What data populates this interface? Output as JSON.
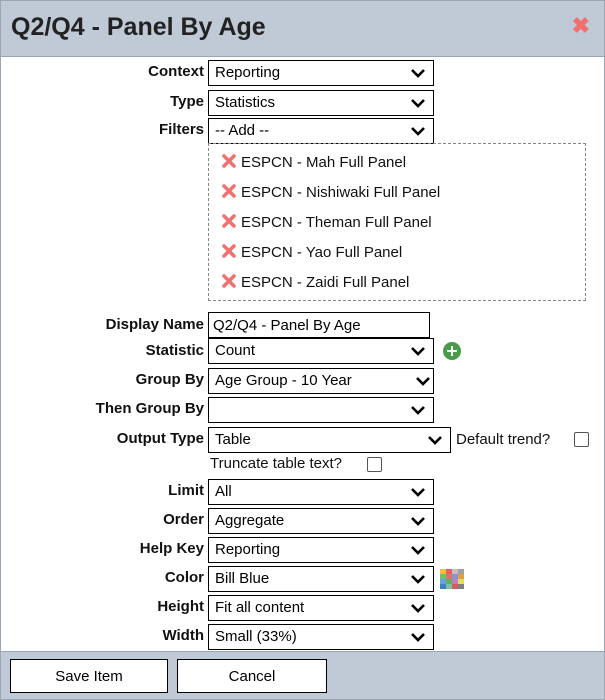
{
  "dialog": {
    "title": "Q2/Q4 - Panel By Age",
    "close_icon": "close-x-icon"
  },
  "form": {
    "context": {
      "label": "Context",
      "value": "Reporting"
    },
    "type": {
      "label": "Type",
      "value": "Statistics"
    },
    "filters": {
      "label": "Filters",
      "add_value": "-- Add --",
      "items": [
        "ESPCN - Mah Full Panel",
        "ESPCN - Nishiwaki Full Panel",
        "ESPCN - Theman Full Panel",
        "ESPCN - Yao Full Panel",
        "ESPCN - Zaidi Full Panel"
      ]
    },
    "display_name": {
      "label": "Display Name",
      "value": "Q2/Q4 - Panel By Age"
    },
    "statistic": {
      "label": "Statistic",
      "value": "Count"
    },
    "group_by": {
      "label": "Group By",
      "value": "Age Group - 10 Year"
    },
    "then_group_by": {
      "label": "Then Group By",
      "value": ""
    },
    "output_type": {
      "label": "Output Type",
      "value": "Table"
    },
    "default_trend": {
      "label": "Default trend?",
      "checked": false
    },
    "truncate_table_text": {
      "label": "Truncate table text?",
      "checked": false
    },
    "limit": {
      "label": "Limit",
      "value": "All"
    },
    "order": {
      "label": "Order",
      "value": "Aggregate"
    },
    "help_key": {
      "label": "Help Key",
      "value": "Reporting"
    },
    "color": {
      "label": "Color",
      "value": "Bill Blue"
    },
    "height": {
      "label": "Height",
      "value": "Fit all content"
    },
    "width": {
      "label": "Width",
      "value": "Small (33%)"
    }
  },
  "footer": {
    "save_label": "Save Item",
    "cancel_label": "Cancel"
  },
  "colors": {
    "header_bg": "#bfcad6",
    "remove_red": "#f07070",
    "add_green": "#4a9a4a"
  }
}
